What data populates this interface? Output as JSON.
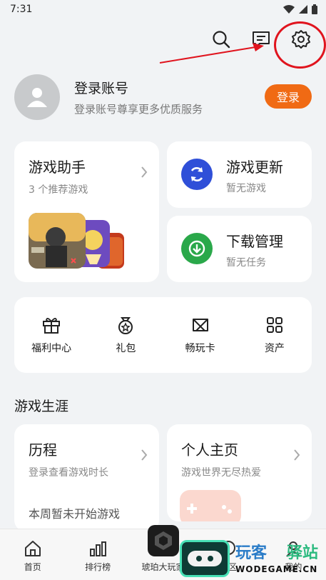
{
  "status_bar": {
    "time": "7:31"
  },
  "account": {
    "title": "登录账号",
    "subtitle": "登录账号尊享更多优质服务",
    "login_label": "登录"
  },
  "assistant": {
    "title": "游戏助手",
    "subtitle": "3 个推荐游戏"
  },
  "update": {
    "title": "游戏更新",
    "subtitle": "暂无游戏"
  },
  "download": {
    "title": "下载管理",
    "subtitle": "暂无任务"
  },
  "quick_items": [
    {
      "label": "福利中心",
      "icon": "gift-icon"
    },
    {
      "label": "礼包",
      "icon": "giftpack-icon"
    },
    {
      "label": "畅玩卡",
      "icon": "playcard-icon"
    },
    {
      "label": "资产",
      "icon": "assets-icon"
    }
  ],
  "career": {
    "section_title": "游戏生涯",
    "history_title": "历程",
    "history_subtitle": "登录查看游戏时长",
    "history_note": "本周暂未开始游戏",
    "profile_title": "个人主页",
    "profile_subtitle": "游戏世界无尽热爱"
  },
  "tabs": [
    {
      "label": "首页",
      "icon": "home-icon"
    },
    {
      "label": "排行榜",
      "icon": "ranking-icon"
    },
    {
      "label": "琥珀大玩家",
      "icon": "amber-icon"
    },
    {
      "label": "社区",
      "icon": "community-icon"
    },
    {
      "label": "我的",
      "icon": "me-icon"
    }
  ],
  "watermark": {
    "text1": "玩客",
    "text2": "驿站",
    "url": "WODEGAME.CN"
  },
  "colors": {
    "accent_orange": "#f06a14",
    "update_blue": "#2f4fd8",
    "download_green": "#2aa84a",
    "annotation_red": "#e0141e"
  }
}
